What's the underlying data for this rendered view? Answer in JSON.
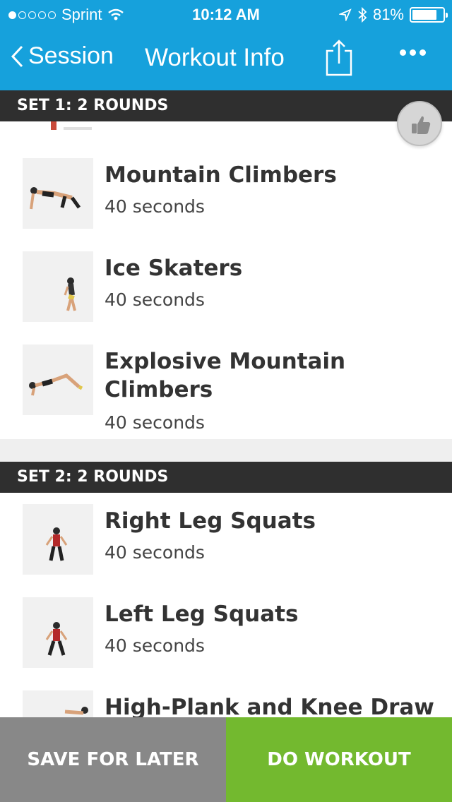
{
  "status_bar": {
    "carrier": "Sprint",
    "time": "10:12 AM",
    "battery": "81%",
    "battery_level": 0.81,
    "icons": [
      "signal-dots-icon",
      "wifi-icon",
      "location-icon",
      "bluetooth-icon",
      "battery-icon"
    ]
  },
  "nav": {
    "back_label": "Session",
    "title": "Workout Info",
    "icons": [
      "back-chevron-icon",
      "share-icon",
      "more-icon"
    ]
  },
  "sets": [
    {
      "header": "SET 1: 2 ROUNDS",
      "exercises": [
        {
          "name": "Mountain Climbers",
          "duration": "40 seconds"
        },
        {
          "name": "Ice Skaters",
          "duration": "40 seconds"
        },
        {
          "name_line1": "Explosive Mountain",
          "name_line2": "Climbers",
          "duration": "40 seconds"
        }
      ]
    },
    {
      "header": "SET 2: 2 ROUNDS",
      "exercises": [
        {
          "name": "Right Leg Squats",
          "duration": "40 seconds"
        },
        {
          "name": "Left Leg Squats",
          "duration": "40 seconds"
        },
        {
          "name": "High-Plank and Knee Draw",
          "duration": ""
        }
      ]
    }
  ],
  "like_button_icon": "thumbs-up-icon",
  "footer": {
    "save_label": "SAVE FOR LATER",
    "do_label": "DO WORKOUT"
  },
  "colors": {
    "header_blue": "#16a1dc",
    "save_gray": "#888888",
    "do_green": "#73b92f",
    "set_header_dark": "#2f2f2f"
  }
}
